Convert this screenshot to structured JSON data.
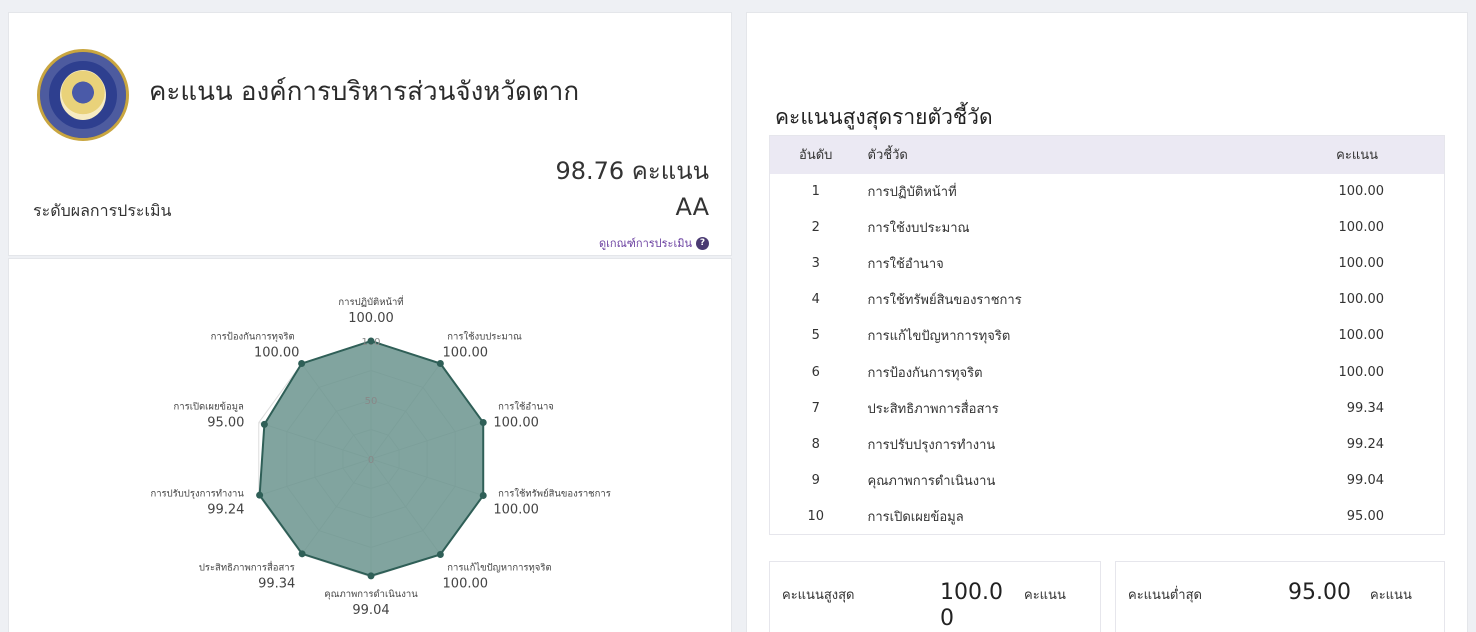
{
  "org": {
    "title": "คะแนน องค์การบริหารส่วนจังหวัดตาก",
    "total_score": "98.76 คะแนน",
    "level_label": "ระดับผลการประเมิน",
    "level_value": "AA",
    "criteria_link": "ดูเกณฑ์การประเมิน",
    "help_icon_glyph": "?"
  },
  "chart_data": {
    "type": "radar",
    "rmax": 100,
    "ticks": [
      "0",
      "50",
      "100"
    ],
    "fill_color": "#6b948e",
    "line_color": "#2f5f57",
    "categories": [
      "การปฏิบัติหน้าที่",
      "การใช้งบประมาณ",
      "การใช้อำนาจ",
      "การใช้ทรัพย์สินของราชการ",
      "การแก้ไขปัญหาการทุจริต",
      "คุณภาพการดำเนินงาน",
      "ประสิทธิภาพการสื่อสาร",
      "การปรับปรุงการทำงาน",
      "การเปิดเผยข้อมูล",
      "การป้องกันการทุจริต"
    ],
    "values": [
      100.0,
      100.0,
      100.0,
      100.0,
      100.0,
      99.04,
      99.34,
      99.24,
      95.0,
      100.0
    ],
    "value_labels": [
      "100.00",
      "100.00",
      "100.00",
      "100.00",
      "100.00",
      "99.04",
      "99.34",
      "99.24",
      "95.00",
      "100.00"
    ]
  },
  "ranking": {
    "heading": "คะแนนสูงสุดรายตัวชี้วัด",
    "columns": [
      "อันดับ",
      "ตัวชี้วัด",
      "คะแนน"
    ],
    "rows": [
      {
        "rank": "1",
        "name": "การปฏิบัติหน้าที่",
        "score": "100.00"
      },
      {
        "rank": "2",
        "name": "การใช้งบประมาณ",
        "score": "100.00"
      },
      {
        "rank": "3",
        "name": "การใช้อำนาจ",
        "score": "100.00"
      },
      {
        "rank": "4",
        "name": "การใช้ทรัพย์สินของราชการ",
        "score": "100.00"
      },
      {
        "rank": "5",
        "name": "การแก้ไขปัญหาการทุจริต",
        "score": "100.00"
      },
      {
        "rank": "6",
        "name": "การป้องกันการทุจริต",
        "score": "100.00"
      },
      {
        "rank": "7",
        "name": "ประสิทธิภาพการสื่อสาร",
        "score": "99.34"
      },
      {
        "rank": "8",
        "name": "การปรับปรุงการทำงาน",
        "score": "99.24"
      },
      {
        "rank": "9",
        "name": "คุณภาพการดำเนินงาน",
        "score": "99.04"
      },
      {
        "rank": "10",
        "name": "การเปิดเผยข้อมูล",
        "score": "95.00"
      }
    ]
  },
  "stats": {
    "max_label": "คะแนนสูงสุด",
    "max_value": "100.00",
    "min_label": "คะแนนต่ำสุด",
    "min_value": "95.00",
    "unit": "คะแนน"
  }
}
